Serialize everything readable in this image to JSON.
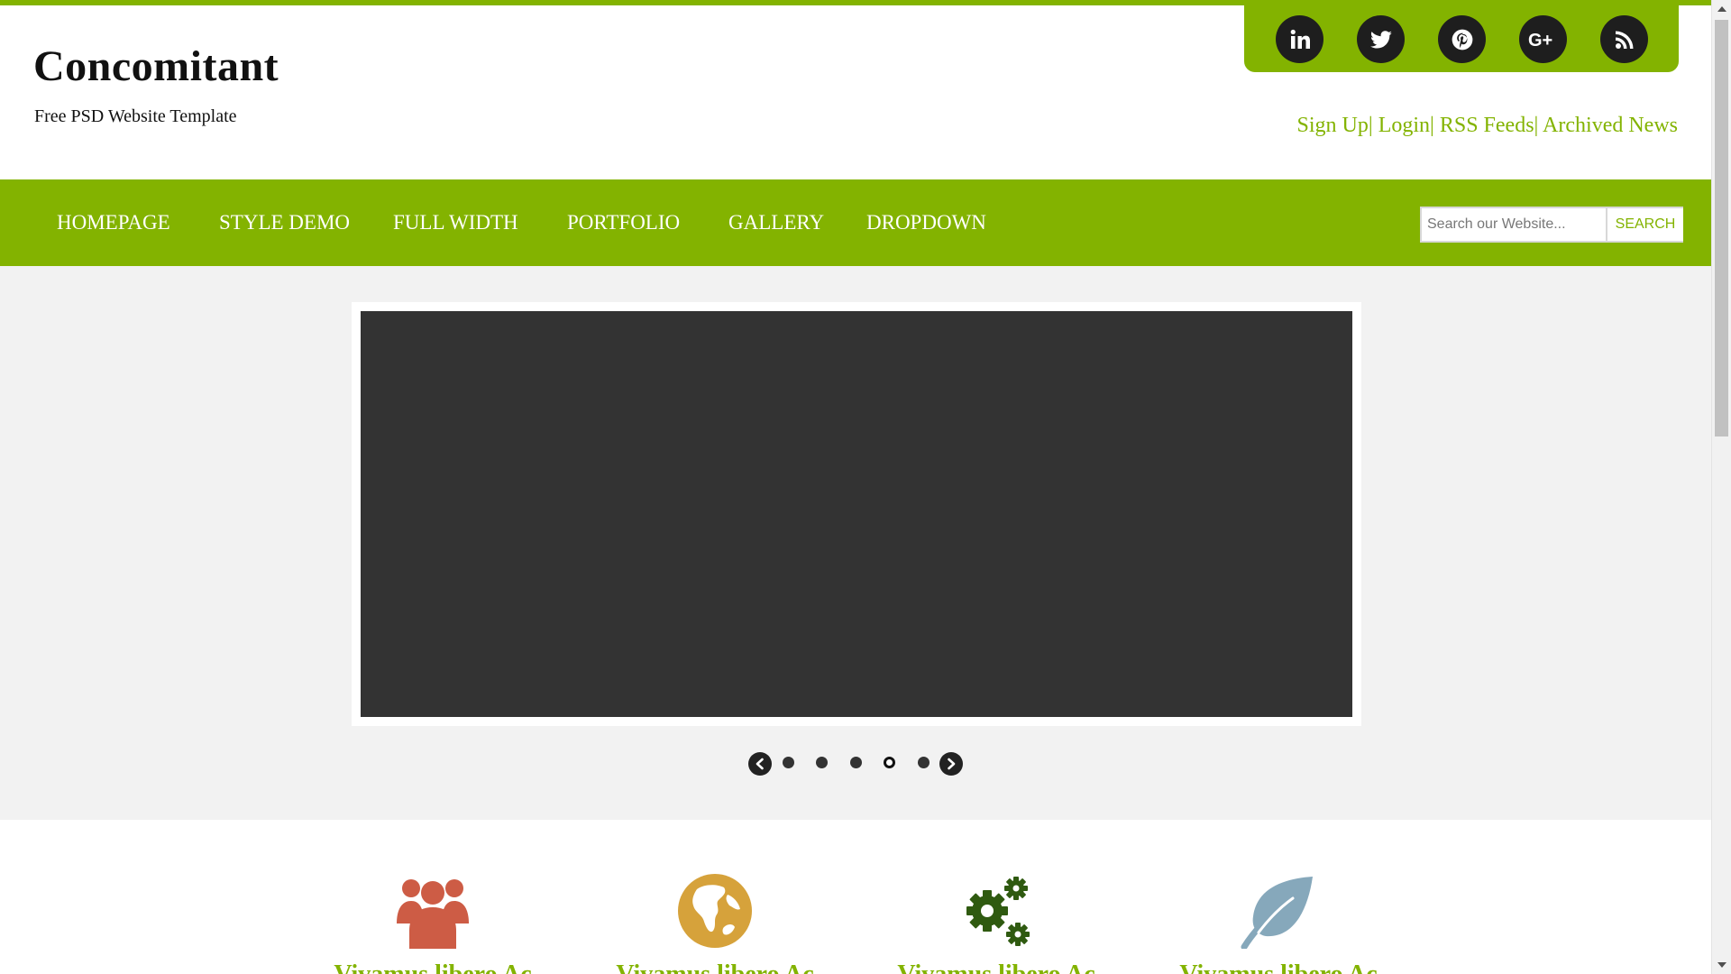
{
  "site": {
    "title": "Concomitant",
    "tagline": "Free PSD Website Template"
  },
  "colors": {
    "accent": "#83b300",
    "dark": "#1e1e1e",
    "slide_bg": "#333333",
    "hero_bg": "#f2f2f2"
  },
  "social": [
    "linkedin-icon",
    "twitter-icon",
    "pinterest-icon",
    "google-plus-icon",
    "rss-icon"
  ],
  "utility_links": {
    "signup": "Sign Up",
    "login": "Login",
    "rss": "RSS Feeds",
    "archive": "Archived News",
    "separator": "|"
  },
  "nav": {
    "home": "HOMEPAGE",
    "style_demo": "STYLE DEMO",
    "full_width": "FULL WIDTH",
    "portfolio": "PORTFOLIO",
    "gallery": "GALLERY",
    "dropdown": "DROPDOWN"
  },
  "search": {
    "placeholder": "Search our Website...",
    "button": "SEARCH"
  },
  "slider": {
    "slide_count": 5,
    "active_index": 4
  },
  "features": [
    {
      "icon": "users-icon",
      "color": "#cd5c45",
      "title": "Vivamus libero Ac"
    },
    {
      "icon": "globe-icon",
      "color": "#d6a23b",
      "title": "Vivamus libero Ac"
    },
    {
      "icon": "gears-icon",
      "color": "#2f5a10",
      "title": "Vivamus libero Ac"
    },
    {
      "icon": "leaf-icon",
      "color": "#86a8bb",
      "title": "Vivamus libero Ac"
    }
  ]
}
